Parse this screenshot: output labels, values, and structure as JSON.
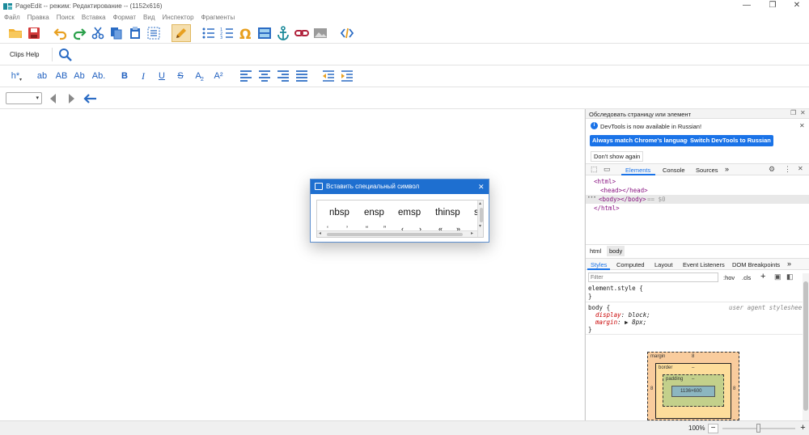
{
  "app": {
    "title": "PageEdit -- режим: Редактирование -- (1152x616)"
  },
  "window_controls": {
    "minimize": "—",
    "maximize": "❐",
    "close": "✕"
  },
  "menu": [
    "Файл",
    "Правка",
    "Поиск",
    "Вставка",
    "Формат",
    "Вид",
    "Инспектор",
    "Фрагменты"
  ],
  "toolbar2": {
    "clips_help": "Clips Help"
  },
  "toolbar3": {
    "heading": "h*",
    "case_lower": "ab",
    "case_upper": "AB",
    "case_title": "Ab",
    "case_sentence": "Ab.",
    "bold": "B",
    "italic": "I",
    "underline": "U",
    "strike": "S",
    "subscript": "A",
    "subscript_mark": "2",
    "superscript": "A²"
  },
  "devtools": {
    "inspect_title": "Обследовать страницу или элемент",
    "info": "DevTools is now available in Russian!",
    "btn_match": "Always match Chrome's language",
    "btn_switch": "Switch DevTools to Russian",
    "dont_show": "Don't show again",
    "tabs": [
      "Elements",
      "Console",
      "Sources"
    ],
    "more_tabs": "»",
    "dom": {
      "line1": "<html>",
      "line2": "<head></head>",
      "line3": "<body></body>",
      "line3_eq": "== $0",
      "line4": "</html>",
      "ellipsis": "•••"
    },
    "breadcrumb": [
      "html",
      "body"
    ],
    "style_tabs": [
      "Styles",
      "Computed",
      "Layout",
      "Event Listeners",
      "DOM Breakpoints"
    ],
    "filter_placeholder": "Filter",
    "hov": ":hov",
    "cls": ".cls",
    "plus": "+",
    "rule1": {
      "selector": "element.style {",
      "close": "}"
    },
    "rule2": {
      "selector": "body {",
      "source": "user agent stylesheet",
      "prop1_name": "display",
      "prop1_value": "block;",
      "prop2_name": "margin",
      "prop2_value": "8px;",
      "close": "}"
    },
    "boxmodel": {
      "margin": "margin",
      "margin_top": "8",
      "margin_left": "8",
      "margin_right": "8",
      "border": "border",
      "border_val": "–",
      "padding": "padding",
      "padding_val": "–",
      "content": "1136×600"
    }
  },
  "dialog": {
    "title": "Вставить специальный символ",
    "symbols_row1": [
      "nbsp",
      "ensp",
      "emsp",
      "thinsp",
      "s"
    ],
    "symbols_row2": [
      "‘",
      "’",
      "“",
      "”",
      "‹",
      "›",
      "«",
      "»"
    ]
  },
  "status": {
    "zoom": "100%",
    "zoom_minus": "−",
    "zoom_plus": "+",
    "zoom_level": 0.5
  },
  "colors": {
    "accent": "#1e6fd0",
    "devtools_blue": "#1a73e8",
    "icon_blue": "#2b6cc4",
    "icon_teal": "#1b8a9a",
    "icon_orange": "#e8a020",
    "icon_red": "#d03030"
  }
}
